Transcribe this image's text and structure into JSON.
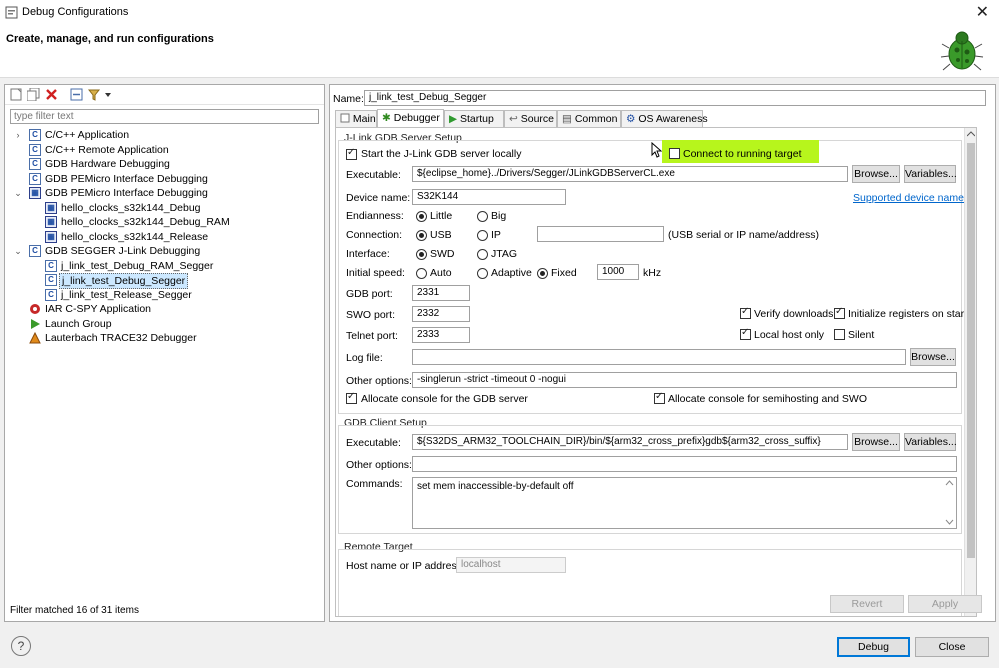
{
  "window": {
    "title": "Debug Configurations",
    "close_glyph": "✕"
  },
  "header": {
    "heading": "Create, manage, and run configurations"
  },
  "left": {
    "filter_placeholder": "type filter text",
    "tree": [
      {
        "label": "C/C++ Application",
        "expanded": false
      },
      {
        "label": "C/C++ Remote Application"
      },
      {
        "label": "GDB Hardware Debugging"
      },
      {
        "label": "GDB PEMicro Interface Debugging"
      },
      {
        "label": "GDB PEMicro Interface Debugging",
        "expanded": true
      },
      {
        "label": "hello_clocks_s32k144_Debug"
      },
      {
        "label": "hello_clocks_s32k144_Debug_RAM"
      },
      {
        "label": "hello_clocks_s32k144_Release"
      },
      {
        "label": "GDB SEGGER J-Link Debugging",
        "expanded": true
      },
      {
        "label": "j_link_test_Debug_RAM_Segger"
      },
      {
        "label": "j_link_test_Debug_Segger",
        "selected": true
      },
      {
        "label": "j_link_test_Release_Segger"
      },
      {
        "label": "IAR C-SPY Application"
      },
      {
        "label": "Launch Group"
      },
      {
        "label": "Lauterbach TRACE32 Debugger"
      }
    ],
    "status": "Filter matched 16 of 31 items"
  },
  "right": {
    "name_label": "Name:",
    "name_value": "j_link_test_Debug_Segger",
    "tabs": [
      "Main",
      "Debugger",
      "Startup",
      "Source",
      "Common",
      "OS Awareness"
    ],
    "server": {
      "section": "J-Link GDB Server Setup",
      "start_locally": "Start the J-Link GDB server locally",
      "connect_running": "Connect to running target",
      "executable_label": "Executable:",
      "executable_value": "${eclipse_home}../Drivers/Segger/JLinkGDBServerCL.exe",
      "browse": "Browse...",
      "variables": "Variables...",
      "device_label": "Device name:",
      "device_value": "S32K144",
      "supported_link": "Supported device names",
      "endianness_label": "Endianness:",
      "little": "Little",
      "big": "Big",
      "connection_label": "Connection:",
      "usb": "USB",
      "ip": "IP",
      "usb_hint": "(USB serial or IP name/address)",
      "interface_label": "Interface:",
      "swd": "SWD",
      "jtag": "JTAG",
      "speed_label": "Initial speed:",
      "auto": "Auto",
      "adaptive": "Adaptive",
      "fixed": "Fixed",
      "speed_value": "1000",
      "khz": "kHz",
      "gdb_port_label": "GDB port:",
      "gdb_port": "2331",
      "swo_port_label": "SWO port:",
      "swo_port": "2332",
      "telnet_port_label": "Telnet port:",
      "telnet_port": "2333",
      "verify": "Verify downloads",
      "init_regs": "Initialize registers on start",
      "local_host": "Local host only",
      "silent": "Silent",
      "log_label": "Log file:",
      "other_label": "Other options:",
      "other_value": "-singlerun -strict -timeout 0 -nogui",
      "alloc_gdb": "Allocate console for the GDB server",
      "alloc_semi": "Allocate console for semihosting and SWO"
    },
    "client": {
      "section": "GDB Client Setup",
      "executable_label": "Executable:",
      "executable_value": "${S32DS_ARM32_TOOLCHAIN_DIR}/bin/${arm32_cross_prefix}gdb${arm32_cross_suffix}",
      "other_label": "Other options:",
      "commands_label": "Commands:",
      "commands_value": "set mem inaccessible-by-default off"
    },
    "remote": {
      "section": "Remote Target",
      "host_label": "Host name or IP address:",
      "host_value": "localhost"
    },
    "revert": "Revert",
    "apply": "Apply"
  },
  "footer": {
    "debug": "Debug",
    "close": "Close",
    "help": "?"
  },
  "colors": {
    "highlight": "#b7f51c",
    "link": "#0066cc",
    "selection": "#cce8ff"
  }
}
